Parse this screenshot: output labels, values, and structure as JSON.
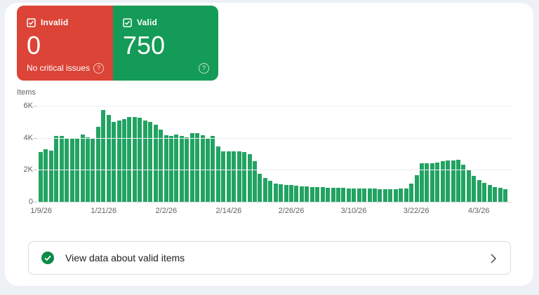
{
  "cards": {
    "invalid": {
      "label": "Invalid",
      "value": "0",
      "subtitle": "No critical issues",
      "color": "#db4437",
      "checked": true
    },
    "valid": {
      "label": "Valid",
      "value": "750",
      "color": "#149b57",
      "checked": true
    }
  },
  "icons": {
    "help": "?"
  },
  "chart_data": {
    "type": "bar",
    "title": "Items",
    "ylabel": "Items",
    "frequency": "daily",
    "bar_color": "#22a362",
    "ylim": [
      0,
      6000
    ],
    "grid": true,
    "y_ticks": [
      {
        "label": "6K",
        "value": 6000
      },
      {
        "label": "4K",
        "value": 4000
      },
      {
        "label": "2K",
        "value": 2000
      },
      {
        "label": "0",
        "value": 0
      }
    ],
    "x_tick_indices": [
      0,
      12,
      24,
      36,
      48,
      60,
      72,
      84
    ],
    "x_tick_labels": [
      "1/9/26",
      "1/21/26",
      "2/2/26",
      "2/14/26",
      "2/26/26",
      "3/10/26",
      "3/22/26",
      "4/3/26"
    ],
    "values": [
      3100,
      3300,
      3200,
      4100,
      4100,
      4000,
      3950,
      4000,
      4200,
      4050,
      4000,
      4700,
      5750,
      5450,
      5000,
      5100,
      5150,
      5300,
      5300,
      5250,
      5100,
      5000,
      4800,
      4500,
      4150,
      4100,
      4200,
      4100,
      4050,
      4300,
      4300,
      4150,
      4000,
      4100,
      3450,
      3150,
      3150,
      3150,
      3150,
      3100,
      3000,
      2550,
      1750,
      1500,
      1300,
      1150,
      1100,
      1050,
      1050,
      1000,
      980,
      950,
      930,
      910,
      900,
      890,
      880,
      870,
      860,
      850,
      850,
      840,
      830,
      830,
      820,
      810,
      800,
      800,
      800,
      820,
      850,
      1130,
      1650,
      2430,
      2400,
      2400,
      2450,
      2520,
      2570,
      2600,
      2630,
      2300,
      1950,
      1600,
      1370,
      1170,
      1050,
      920,
      870,
      780
    ]
  },
  "footer": {
    "label": "View data about valid items"
  }
}
